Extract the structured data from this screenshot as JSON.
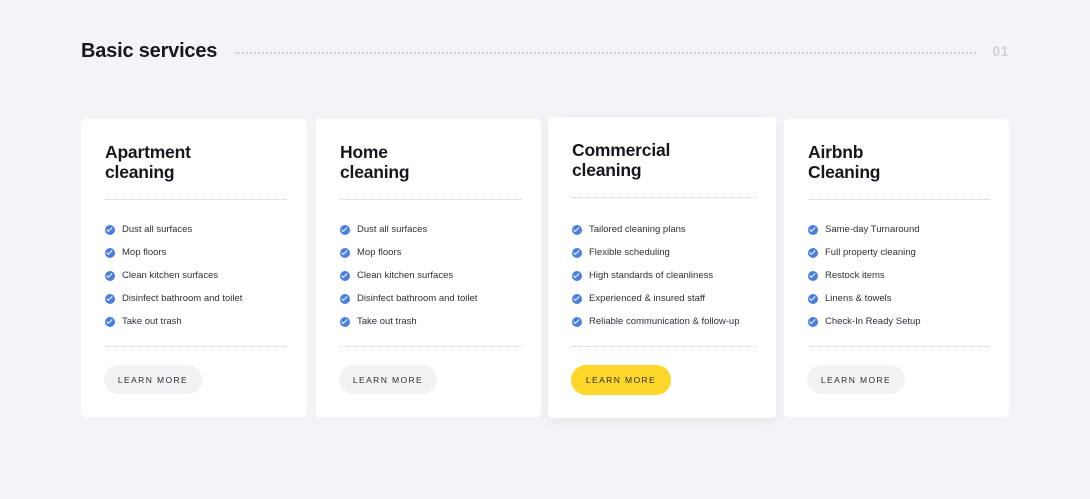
{
  "header": {
    "title": "Basic services",
    "number": "01"
  },
  "cards": [
    {
      "title_line1": "Apartment",
      "title_line2": "cleaning",
      "features": [
        "Dust all surfaces",
        "Mop floors",
        "Clean kitchen surfaces",
        "Disinfect bathroom and toilet",
        "Take out trash"
      ],
      "button": "LEARN MORE",
      "featured": false
    },
    {
      "title_line1": "Home",
      "title_line2": "cleaning",
      "features": [
        "Dust all surfaces",
        "Mop floors",
        "Clean kitchen surfaces",
        "Disinfect bathroom and toilet",
        "Take out trash"
      ],
      "button": "LEARN MORE",
      "featured": false
    },
    {
      "title_line1": "Commercial",
      "title_line2": "cleaning",
      "features": [
        "Tailored cleaning plans",
        "Flexible scheduling",
        "High standards of cleanliness",
        "Experienced & insured staff",
        "Reliable communication & follow-up"
      ],
      "button": "LEARN MORE",
      "featured": true
    },
    {
      "title_line1": "Airbnb",
      "title_line2": "Cleaning",
      "features": [
        "Same-day Turnaround",
        "Full property cleaning",
        "Restock items",
        "Linens & towels",
        "Check-In Ready Setup"
      ],
      "button": "LEARN MORE",
      "featured": false
    }
  ],
  "colors": {
    "accent_button": "#fcd72a",
    "check": "#4a7fe0",
    "background": "#f3f4f7"
  },
  "icons": {
    "feature_bullet": "check-circle-icon"
  }
}
